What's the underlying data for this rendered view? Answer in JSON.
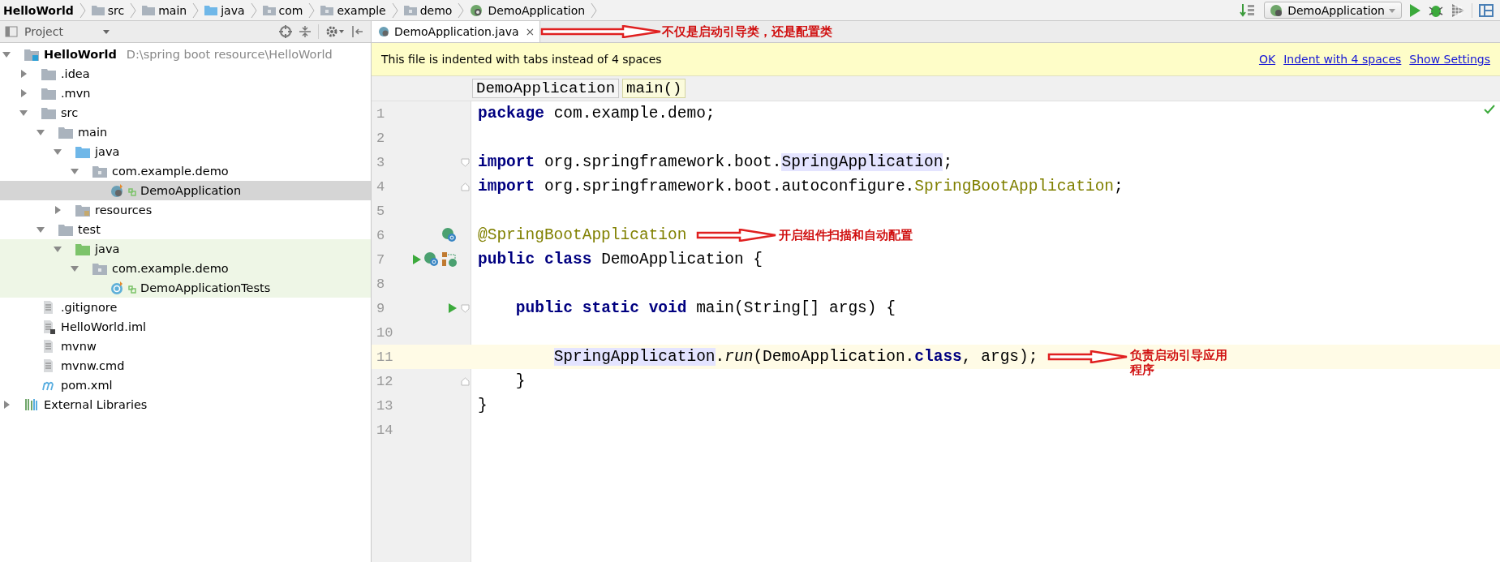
{
  "breadcrumbs": [
    {
      "label": "HelloWorld",
      "kind": "project"
    },
    {
      "label": "src",
      "kind": "folder"
    },
    {
      "label": "main",
      "kind": "folder"
    },
    {
      "label": "java",
      "kind": "source-folder"
    },
    {
      "label": "com",
      "kind": "package"
    },
    {
      "label": "example",
      "kind": "package"
    },
    {
      "label": "demo",
      "kind": "package"
    },
    {
      "label": "DemoApplication",
      "kind": "class"
    }
  ],
  "run_config": {
    "label": "DemoApplication"
  },
  "project_panel": {
    "title": "Project",
    "tree": [
      {
        "label": "HelloWorld",
        "detail": "D:\\spring boot resource\\HelloWorld",
        "kind": "module",
        "expanded": true,
        "selected": false,
        "test_scope": false,
        "children": [
          {
            "label": ".idea",
            "kind": "folder",
            "expanded": false,
            "selected": false,
            "test_scope": false
          },
          {
            "label": ".mvn",
            "kind": "folder",
            "expanded": false,
            "selected": false,
            "test_scope": false
          },
          {
            "label": "src",
            "kind": "folder",
            "expanded": true,
            "selected": false,
            "test_scope": false,
            "children": [
              {
                "label": "main",
                "kind": "folder",
                "expanded": true,
                "selected": false,
                "test_scope": false,
                "children": [
                  {
                    "label": "java",
                    "kind": "source-folder",
                    "expanded": true,
                    "selected": false,
                    "test_scope": false,
                    "children": [
                      {
                        "label": "com.example.demo",
                        "kind": "package",
                        "expanded": true,
                        "selected": false,
                        "test_scope": false,
                        "children": [
                          {
                            "label": "DemoApplication",
                            "kind": "boot-class",
                            "selected": true,
                            "test_scope": false
                          }
                        ]
                      }
                    ]
                  },
                  {
                    "label": "resources",
                    "kind": "resources",
                    "expanded": false,
                    "selected": false,
                    "test_scope": false
                  }
                ]
              },
              {
                "label": "test",
                "kind": "folder",
                "expanded": true,
                "selected": false,
                "test_scope": false,
                "children": [
                  {
                    "label": "java",
                    "kind": "test-folder",
                    "expanded": true,
                    "selected": false,
                    "test_scope": true,
                    "children": [
                      {
                        "label": "com.example.demo",
                        "kind": "package",
                        "expanded": true,
                        "selected": false,
                        "test_scope": true,
                        "children": [
                          {
                            "label": "DemoApplicationTests",
                            "kind": "test-class",
                            "selected": false,
                            "test_scope": true
                          }
                        ]
                      }
                    ]
                  }
                ]
              }
            ]
          },
          {
            "label": ".gitignore",
            "kind": "file",
            "selected": false,
            "test_scope": false
          },
          {
            "label": "HelloWorld.iml",
            "kind": "iml",
            "selected": false,
            "test_scope": false
          },
          {
            "label": "mvnw",
            "kind": "file",
            "selected": false,
            "test_scope": false
          },
          {
            "label": "mvnw.cmd",
            "kind": "file",
            "selected": false,
            "test_scope": false
          },
          {
            "label": "pom.xml",
            "kind": "maven",
            "selected": false,
            "test_scope": false
          }
        ]
      },
      {
        "label": "External Libraries",
        "kind": "libraries",
        "expanded": false,
        "selected": false,
        "test_scope": false
      }
    ]
  },
  "editor_tabs": [
    {
      "label": "DemoApplication.java",
      "close": "×",
      "selected": true,
      "note": "不仅是启动引导类，还是配置类"
    }
  ],
  "notice": {
    "message": "This file is indented with tabs instead of 4 spaces",
    "actions": [
      "OK",
      "Indent with 4 spaces",
      "Show Settings"
    ]
  },
  "editor_breadcrumbs": [
    {
      "label": "DemoApplication",
      "selected": false
    },
    {
      "label": "main()",
      "selected": true
    }
  ],
  "code": [
    {
      "number": "1",
      "current": false,
      "fold_open": false,
      "fold_close": false,
      "tokens": [
        {
          "t": "package",
          "kind": "keyword"
        },
        {
          "t": " com.example.demo;",
          "kind": "plain"
        }
      ]
    },
    {
      "number": "2",
      "current": false,
      "fold_open": false,
      "fold_close": false
    },
    {
      "number": "3",
      "current": false,
      "fold_open": true,
      "fold_close": false,
      "tokens": [
        {
          "t": "import",
          "kind": "keyword"
        },
        {
          "t": " org.springframework.boot.",
          "kind": "plain"
        },
        {
          "t": "SpringApplication",
          "kind": "used"
        },
        {
          "t": ";",
          "kind": "plain"
        }
      ]
    },
    {
      "number": "4",
      "current": false,
      "fold_open": false,
      "fold_close": true,
      "tokens": [
        {
          "t": "import",
          "kind": "keyword"
        },
        {
          "t": " org.springframework.boot.autoconfigure.",
          "kind": "plain"
        },
        {
          "t": "SpringBootApplication",
          "kind": "annotation"
        },
        {
          "t": ";",
          "kind": "plain"
        }
      ]
    },
    {
      "number": "5",
      "current": false,
      "fold_open": false,
      "fold_close": false
    },
    {
      "number": "6",
      "current": false,
      "fold_open": false,
      "fold_close": false,
      "gutter": [
        {
          "kind": "bean"
        }
      ],
      "tokens": [
        {
          "t": "@SpringBootApplication",
          "kind": "annotation"
        }
      ],
      "note": "开启组件扫描和自动配置"
    },
    {
      "number": "7",
      "current": false,
      "fold_open": false,
      "fold_close": false,
      "gutter": [
        {
          "kind": "run"
        },
        {
          "kind": "bean"
        },
        {
          "kind": "config"
        }
      ],
      "tokens": [
        {
          "t": "public",
          "kind": "keyword"
        },
        {
          "t": " class",
          "kind": "keyword"
        },
        {
          "t": " DemoApplication {",
          "kind": "plain"
        }
      ]
    },
    {
      "number": "8",
      "current": false,
      "fold_open": false,
      "fold_close": false
    },
    {
      "number": "9",
      "current": false,
      "fold_open": true,
      "fold_close": false,
      "gutter": [
        {
          "kind": "run"
        }
      ],
      "tokens": [
        {
          "t": "    public",
          "kind": "keyword"
        },
        {
          "t": " static",
          "kind": "keyword"
        },
        {
          "t": " void",
          "kind": "keyword"
        },
        {
          "t": " main(String[] args) {",
          "kind": "plain"
        }
      ]
    },
    {
      "number": "10",
      "current": false,
      "fold_open": false,
      "fold_close": false
    },
    {
      "number": "11",
      "current": true,
      "fold_open": false,
      "fold_close": false,
      "tokens": [
        {
          "t": "        SpringApplication",
          "kind": "used"
        },
        {
          "t": ".",
          "kind": "plain"
        },
        {
          "t": "run",
          "kind": "method"
        },
        {
          "t": "(DemoApplication.",
          "kind": "plain"
        },
        {
          "t": "class",
          "kind": "keyword"
        },
        {
          "t": ", args);",
          "kind": "plain"
        }
      ],
      "note": "负责启动引导应用程序"
    },
    {
      "number": "12",
      "current": false,
      "fold_open": false,
      "fold_close": true,
      "tokens": [
        {
          "t": "    }",
          "kind": "plain"
        }
      ]
    },
    {
      "number": "13",
      "current": false,
      "fold_open": false,
      "fold_close": false,
      "tokens": [
        {
          "t": "}",
          "kind": "plain"
        }
      ]
    },
    {
      "number": "14",
      "current": false,
      "fold_open": false,
      "fold_close": false
    }
  ]
}
